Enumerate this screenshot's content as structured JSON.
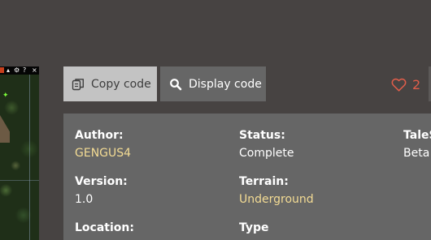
{
  "toolbar": {
    "copy_label": "Copy code",
    "display_label": "Display code",
    "likes_count": "2"
  },
  "thumbnail": {
    "control_icons": [
      "■",
      "▴",
      "⚙",
      "?",
      "×"
    ],
    "marker": "✦"
  },
  "details": {
    "author": {
      "label": "Author:",
      "value": "GENGUS4"
    },
    "status": {
      "label": "Status:",
      "value": "Complete"
    },
    "tales": {
      "label": "TaleS",
      "value": "Beta"
    },
    "version": {
      "label": "Version:",
      "value": "1.0"
    },
    "terrain": {
      "label": "Terrain:",
      "value": "Underground"
    },
    "location": {
      "label": "Location:"
    },
    "type": {
      "label": "Type"
    }
  },
  "colors": {
    "page_bg": "#474342",
    "panel_bg": "#666666",
    "copy_button_bg": "#c3c3c3",
    "link_value": "#f4dc94",
    "likes": "#e05d4a"
  },
  "icons": {
    "copy": "copy-icon",
    "search": "search-icon",
    "heart": "heart-icon"
  }
}
